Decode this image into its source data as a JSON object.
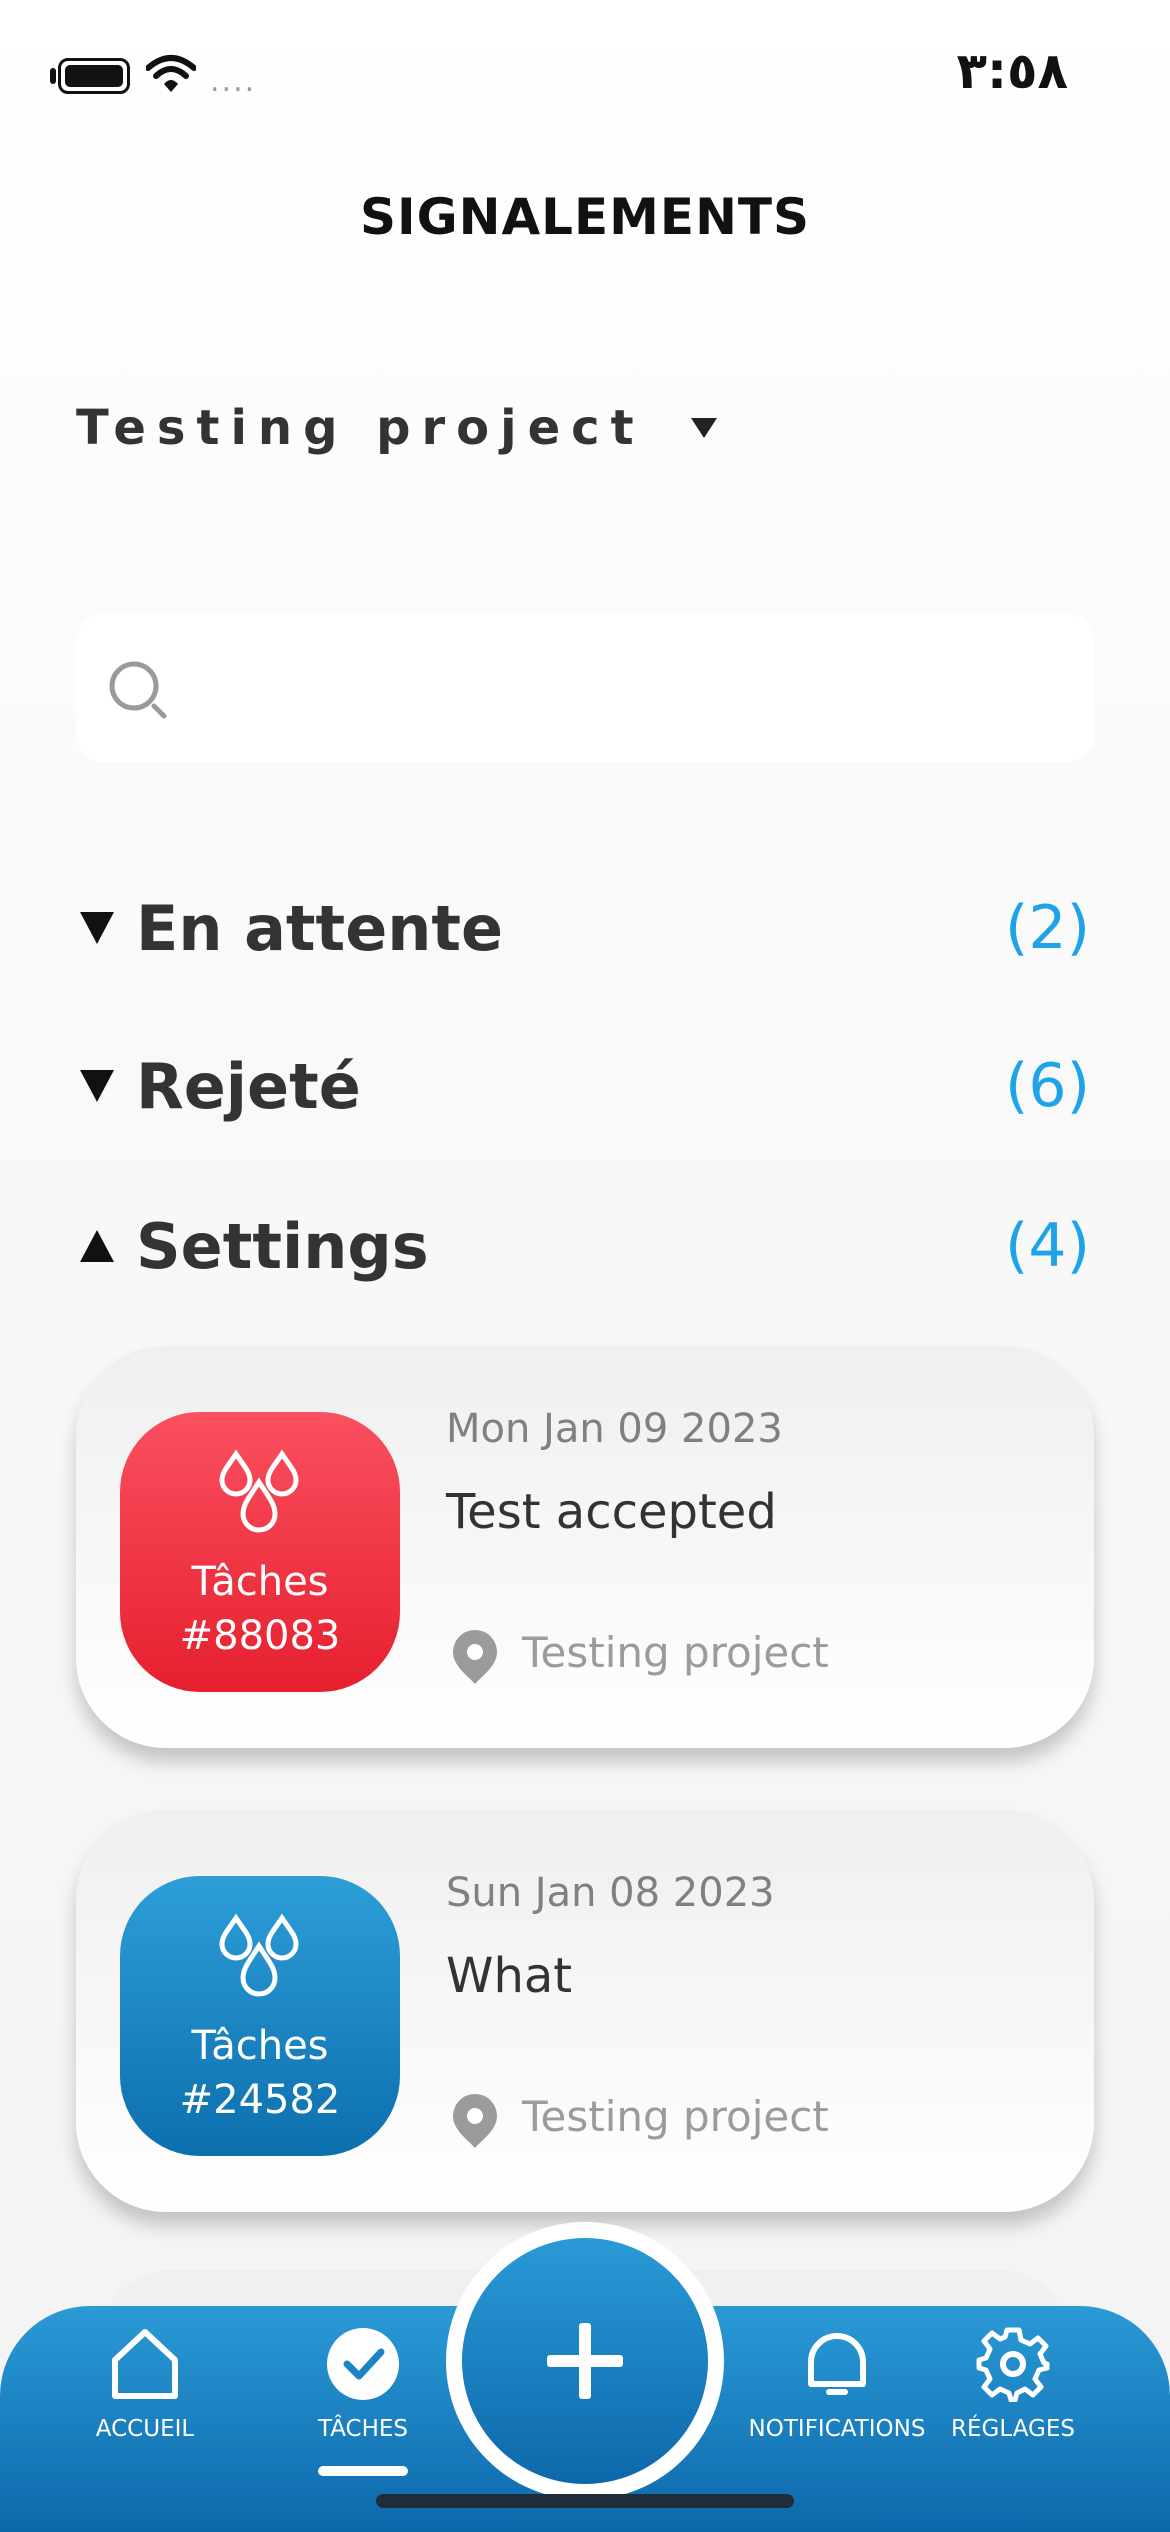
{
  "status_bar": {
    "time": "٣:٥٨",
    "signal": "...."
  },
  "header": {
    "title": "SIGNALEMENTS"
  },
  "project_selector": {
    "label": "Testing project"
  },
  "search": {
    "placeholder": ""
  },
  "sections": [
    {
      "title": "En attente",
      "count": "(2)",
      "expanded": false
    },
    {
      "title": "Rejeté",
      "count": "(6)",
      "expanded": false
    },
    {
      "title": "Settings",
      "count": "(4)",
      "expanded": true
    }
  ],
  "cards": [
    {
      "badge_label": "Tâches",
      "badge_number": "#88083",
      "badge_color": "#e61f2e",
      "date": "Mon Jan 09 2023",
      "title": "Test accepted",
      "location": "Testing project"
    },
    {
      "badge_label": "Tâches",
      "badge_number": "#24582",
      "badge_color": "#0c6fad",
      "date": "Sun Jan 08 2023",
      "title": "What",
      "location": "Testing project"
    }
  ],
  "bottom_nav": {
    "items": [
      {
        "label": "ACCUEIL",
        "icon": "home-icon"
      },
      {
        "label": "TÂCHES",
        "icon": "check-circle-icon",
        "active": true
      },
      {
        "label": "NOTIFICATIONS",
        "icon": "bell-icon"
      },
      {
        "label": "RÉGLAGES",
        "icon": "gear-icon"
      }
    ],
    "fab_icon": "plus-icon"
  },
  "colors": {
    "accent": "#1fa3e8",
    "nav_blue": "#0d68aa",
    "red": "#e61f2e"
  }
}
